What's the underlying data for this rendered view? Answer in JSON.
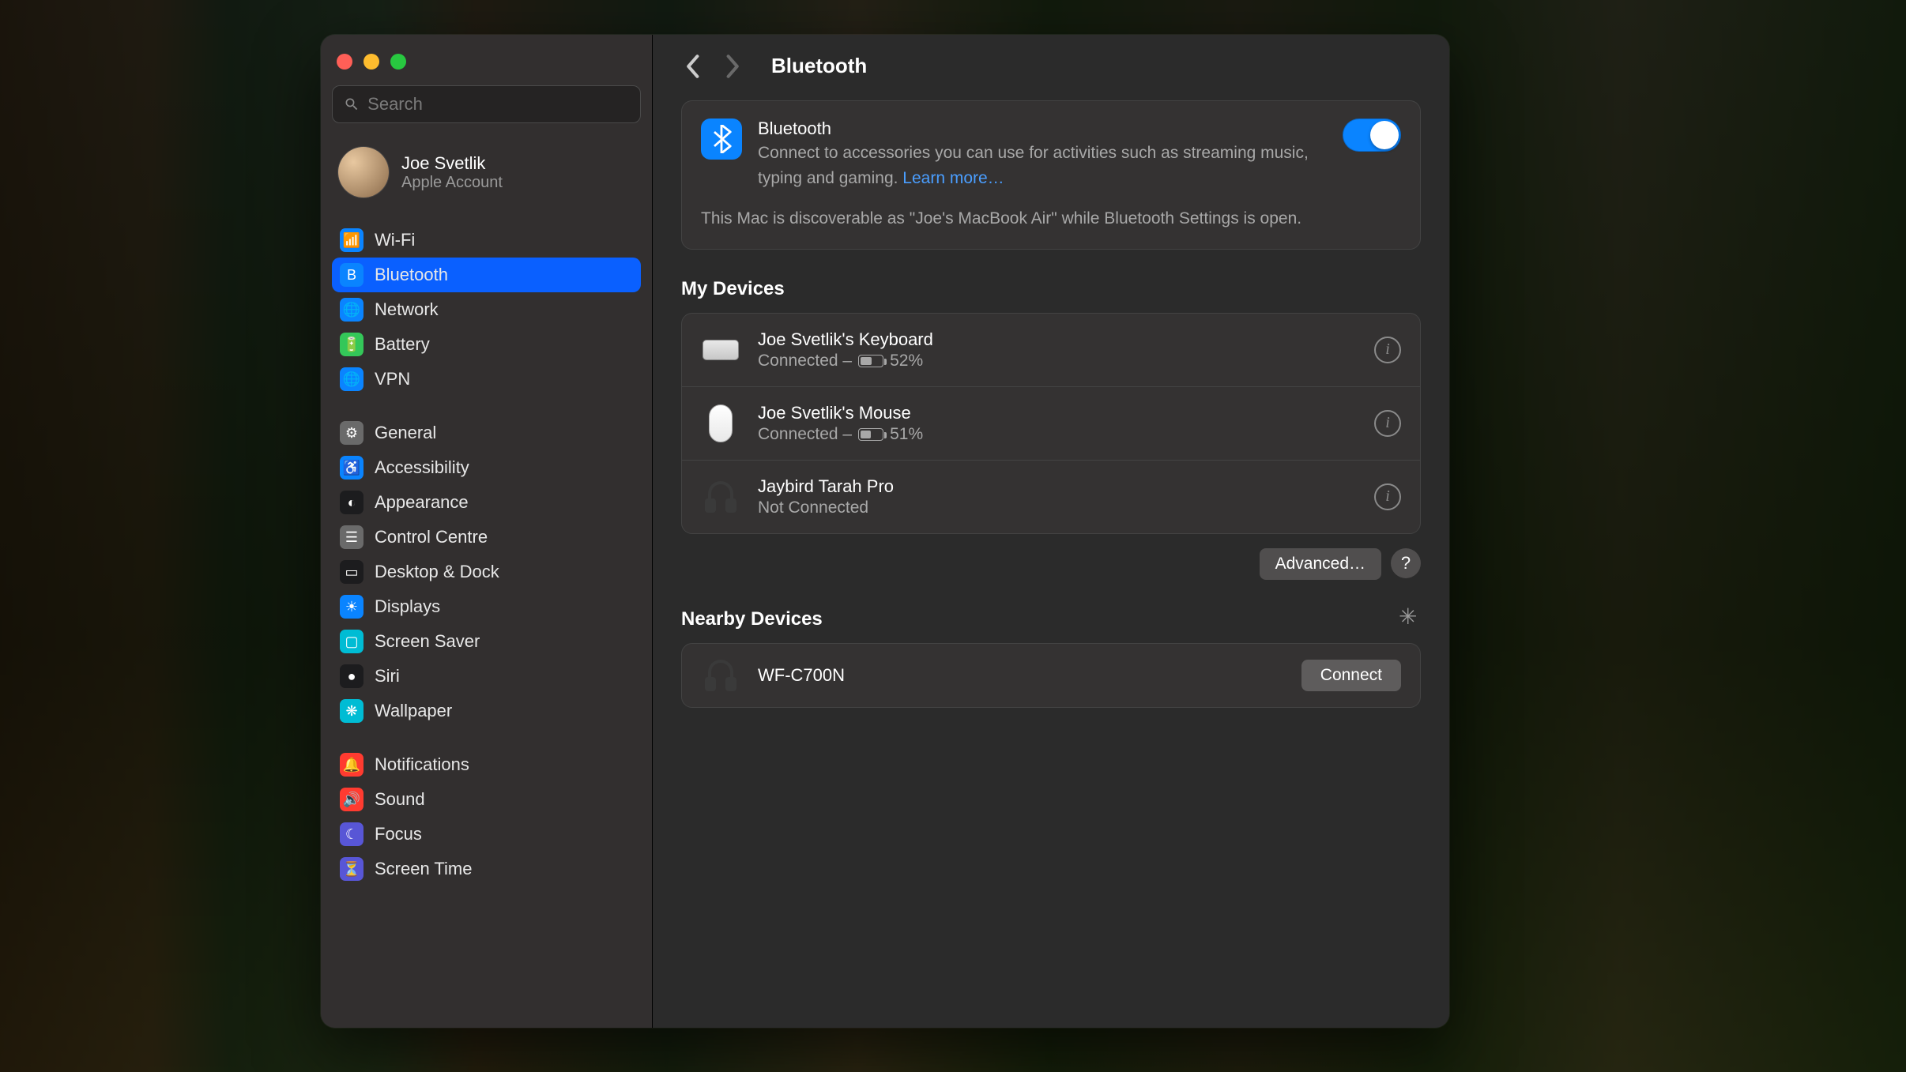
{
  "search": {
    "placeholder": "Search"
  },
  "account": {
    "name": "Joe Svetlik",
    "sub": "Apple Account"
  },
  "sidebar": {
    "group1": [
      {
        "label": "Wi-Fi",
        "color": "#0a84ff",
        "glyph": "📶"
      },
      {
        "label": "Bluetooth",
        "color": "#0a84ff",
        "glyph": "B",
        "selected": true
      },
      {
        "label": "Network",
        "color": "#0a84ff",
        "glyph": "🌐"
      },
      {
        "label": "Battery",
        "color": "#34c759",
        "glyph": "🔋"
      },
      {
        "label": "VPN",
        "color": "#0a84ff",
        "glyph": "🌐"
      }
    ],
    "group2": [
      {
        "label": "General",
        "color": "#6a6a6a",
        "glyph": "⚙"
      },
      {
        "label": "Accessibility",
        "color": "#0a84ff",
        "glyph": "♿"
      },
      {
        "label": "Appearance",
        "color": "#1c1c1e",
        "glyph": "◐"
      },
      {
        "label": "Control Centre",
        "color": "#6a6a6a",
        "glyph": "☰"
      },
      {
        "label": "Desktop & Dock",
        "color": "#1c1c1e",
        "glyph": "▭"
      },
      {
        "label": "Displays",
        "color": "#0a84ff",
        "glyph": "☀"
      },
      {
        "label": "Screen Saver",
        "color": "#00bcd4",
        "glyph": "▢"
      },
      {
        "label": "Siri",
        "color": "#1c1c1e",
        "glyph": "●"
      },
      {
        "label": "Wallpaper",
        "color": "#00bcd4",
        "glyph": "❋"
      }
    ],
    "group3": [
      {
        "label": "Notifications",
        "color": "#ff3b30",
        "glyph": "🔔"
      },
      {
        "label": "Sound",
        "color": "#ff3b30",
        "glyph": "🔊"
      },
      {
        "label": "Focus",
        "color": "#5856d6",
        "glyph": "☾"
      },
      {
        "label": "Screen Time",
        "color": "#5856d6",
        "glyph": "⏳"
      }
    ]
  },
  "header": {
    "title": "Bluetooth"
  },
  "bluetooth": {
    "title": "Bluetooth",
    "desc": "Connect to accessories you can use for activities such as streaming music, typing and gaming. ",
    "learn_more": "Learn more…",
    "discoverable": "This Mac is discoverable as \"Joe's MacBook Air\" while Bluetooth Settings is open.",
    "enabled": true
  },
  "my_devices": {
    "title": "My Devices",
    "items": [
      {
        "name": "Joe Svetlik's Keyboard",
        "status": "Connected – ",
        "battery": "52%",
        "battery_pct": 52,
        "icon": "keyboard"
      },
      {
        "name": "Joe Svetlik's Mouse",
        "status": "Connected – ",
        "battery": "51%",
        "battery_pct": 51,
        "icon": "mouse"
      },
      {
        "name": "Jaybird Tarah Pro",
        "status": "Not Connected",
        "icon": "headphones"
      }
    ]
  },
  "advanced_label": "Advanced…",
  "nearby": {
    "title": "Nearby Devices",
    "items": [
      {
        "name": "WF-C700N",
        "icon": "headphones",
        "action": "Connect"
      }
    ]
  }
}
